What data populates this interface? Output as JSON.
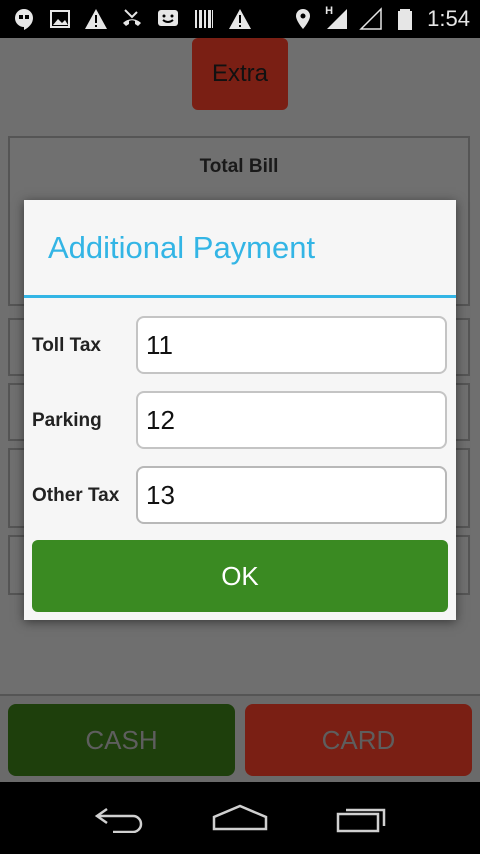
{
  "status_bar": {
    "left_icons": [
      "hangouts-icon",
      "image-icon",
      "warning-icon",
      "missed-call-icon",
      "smiley-icon",
      "barcode-icon",
      "warning-icon"
    ],
    "right_icons": [
      "location-icon",
      "signal-h-icon",
      "signal-empty-icon",
      "battery-icon"
    ],
    "signal_label": "H",
    "time": "1:54"
  },
  "background": {
    "extra_label": "Extra",
    "bill_title": "Total Bill",
    "cash_label": "CASH",
    "card_label": "CARD"
  },
  "dialog": {
    "title": "Additional Payment",
    "fields": [
      {
        "label": "Toll Tax",
        "value": "11"
      },
      {
        "label": "Parking",
        "value": "12"
      },
      {
        "label": "Other Tax",
        "value": "13"
      }
    ],
    "ok_label": "OK"
  },
  "colors": {
    "accent": "#33b5e5",
    "ok_green": "#3a8a22",
    "cash_green": "#1e3f0c",
    "card_red": "#7a1f14"
  },
  "nav_bar": {
    "icons": [
      "back-icon",
      "home-icon",
      "recents-icon"
    ]
  }
}
